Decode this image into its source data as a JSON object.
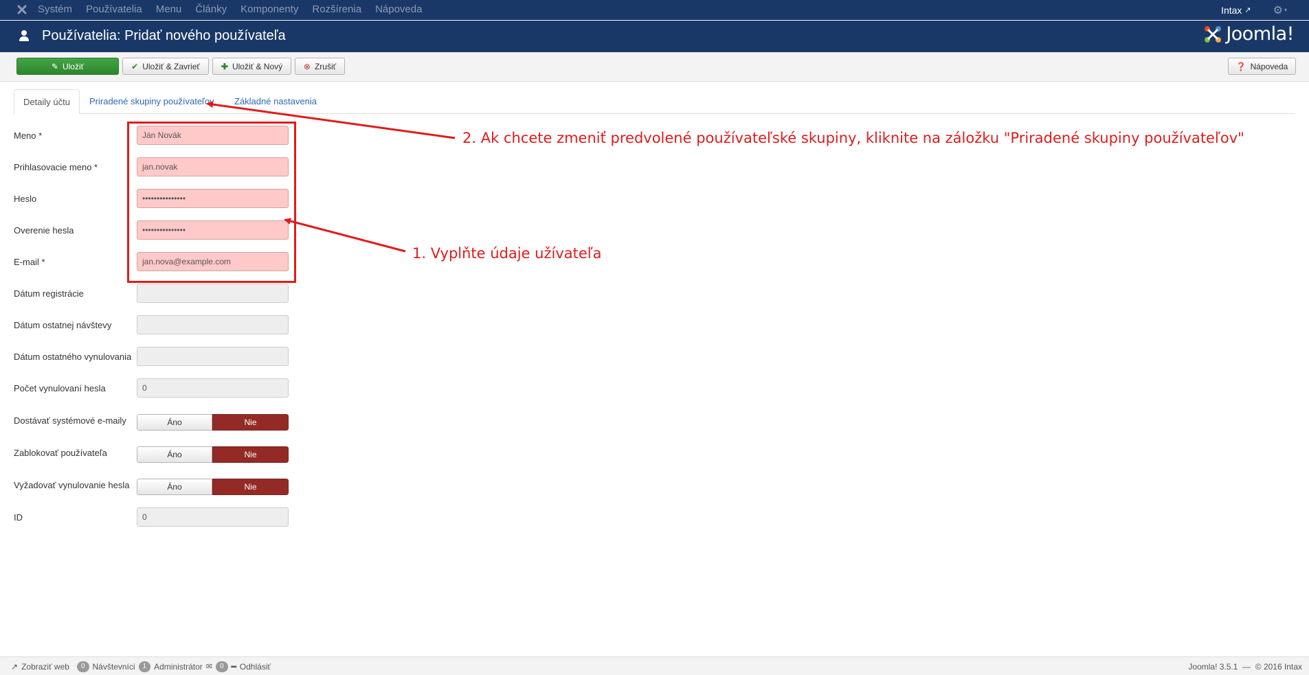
{
  "topnav": {
    "menu": [
      "Systém",
      "Používatelia",
      "Menu",
      "Články",
      "Komponenty",
      "Rozšírenia",
      "Nápoveda"
    ],
    "site_link": "Intax",
    "settings_icon": "gear-icon"
  },
  "header": {
    "title": "Používatelia: Pridať nového používateľa",
    "brand": "Joomla!"
  },
  "toolbar": {
    "save": "Uložiť",
    "save_close": "Uložiť & Zavrieť",
    "save_new": "Uložiť & Nový",
    "cancel": "Zrušiť",
    "help": "Nápoveda"
  },
  "tabs": [
    "Detaily účtu",
    "Priradené skupiny používateľov",
    "Základné nastavenia"
  ],
  "form": {
    "name": {
      "label": "Meno *",
      "value": "Ján Novák"
    },
    "username": {
      "label": "Prihlasovacie meno *",
      "value": "jan.novak"
    },
    "password": {
      "label": "Heslo",
      "value": "•••••••••••••••"
    },
    "password2": {
      "label": "Overenie hesla",
      "value": "•••••••••••••••"
    },
    "email": {
      "label": "E-mail *",
      "value": "jan.nova@example.com"
    },
    "register_date": {
      "label": "Dátum registrácie",
      "value": ""
    },
    "last_visit": {
      "label": "Dátum ostatnej návštevy",
      "value": ""
    },
    "last_reset": {
      "label": "Dátum ostatného vynulovania",
      "value": ""
    },
    "reset_count": {
      "label": "Počet vynulovaní hesla",
      "value": "0"
    },
    "send_email": {
      "label": "Dostávať systémové e-maily",
      "yes": "Áno",
      "no": "Nie",
      "selected": "Nie"
    },
    "block": {
      "label": "Zablokovať používateľa",
      "yes": "Áno",
      "no": "Nie",
      "selected": "Nie"
    },
    "require_reset": {
      "label": "Vyžadovať vynulovanie hesla",
      "yes": "Áno",
      "no": "Nie",
      "selected": "Nie"
    },
    "id": {
      "label": "ID",
      "value": "0"
    }
  },
  "annotations": {
    "step1": "1. Vyplňte údaje užívateľa",
    "step2": "2. Ak chcete zmeniť predvolené používateľské skupiny, kliknite na záložku \"Priradené skupiny používateľov\""
  },
  "statusbar": {
    "view_site": "Zobraziť web",
    "visitors_count": "0",
    "visitors_label": "Návštevníci",
    "admins_count": "1",
    "admins_label": "Administrátor",
    "messages_count": "0",
    "logout": "Odhlásiť",
    "version": "Joomla! 3.5.1  —  © 2016 Intax"
  },
  "colors": {
    "nav_bg": "#1a3867",
    "save_green": "#2d862d",
    "toggle_no_red": "#942a25",
    "annotation_red": "#e01b1b",
    "highlight_field": "#ffc9c9"
  }
}
